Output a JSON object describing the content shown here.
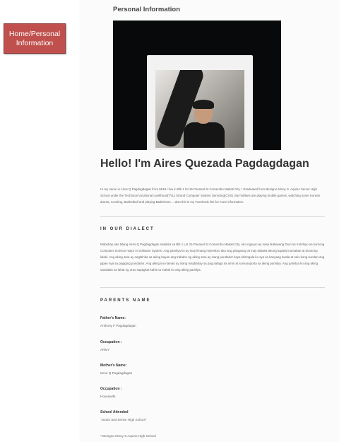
{
  "nav": {
    "home_label": "Home/Personal Information"
  },
  "page": {
    "title": "Personal Information"
  },
  "profile": {
    "heading": "Hello! I'm Aires Quezada Pagdagdagan",
    "intro": "Hi my name is Aires Q Pagdagdagan from 5518 I live in Blk 1 lot 15 Pavanal St Comembo Makati City. I Graduated from Benigno Ninoy S. Aquino Senior High School under the Technical Vocational Livelihood(TVL) Strand Computer System Servicing(CSS). My hobbies are playing mobile games, watching some Korean drama, Cooking, Basketball and playing Badminton. ...also this is my Facebook link for more information."
  },
  "dialect": {
    "heading": "IN OUR DIALECT",
    "text": "Mabuhay ako bilang Aires Q Pagdagdagan nakatira sa Blk 1 Lot 15 Pavanal St Comembo Makati City. Ako ngayon ay nasa Ikalawang Taon sa Kolehiyo sa kursong Computer Science major in Software System. Ang pamilya ko ay may limang miyembro ako ang panganay at may dalawa akong kapatid na babae at bunsong lalaki. Ang aking ama ay nagtitinda sa aking bayan ang trabaho ng aking ama ay isang pundador kaya tinitingala ko sya sa kanyang tiwala at nais kong sundan ang japan nya sa pagiging pundador. Ang aking ina naman ay isang maybahay sa pag aalaga sa amin at sumusuporta sa aking pamilya. Ang pamilya ko ang aking sandalan sa lahat ng oras sapagkat kahit na mahal ko ang aking pamilya."
  },
  "parents": {
    "heading": "PARENTS NAME",
    "father_label": "Father's Name:",
    "father_value": "Anthony F Pagdagdagan",
    "father_occ_label": "Occupation :",
    "father_occ_value": "ARMY",
    "mother_label": "Mother's Name:",
    "mother_value": "Irene Q Pagdagdagan",
    "mother_occ_label": "Occupation :",
    "mother_occ_value": "Housewife"
  },
  "school": {
    "label": "School Attended",
    "value": "\"Junior and Senior High School\"",
    "name": "* Benigno Ninoy S Aquino High School"
  }
}
